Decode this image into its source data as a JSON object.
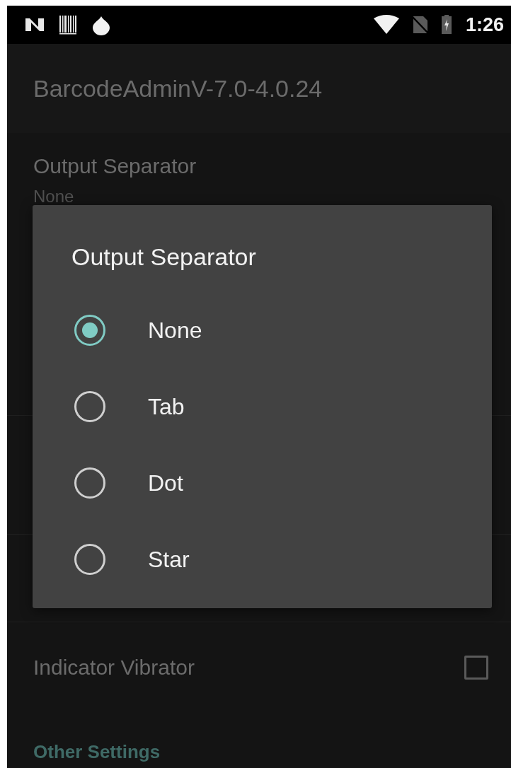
{
  "status_bar": {
    "time": "1:26"
  },
  "app_bar": {
    "title": "BarcodeAdminV-7.0-4.0.24"
  },
  "settings": [
    {
      "kind": "preference",
      "title": "Output Separator",
      "summary": "None"
    },
    {
      "kind": "checkbox",
      "title": "Indicator Vibrator",
      "checked": false
    },
    {
      "kind": "category",
      "title": "Other Settings"
    }
  ],
  "dialog": {
    "title": "Output Separator",
    "options": [
      {
        "label": "None",
        "selected": true
      },
      {
        "label": "Tab",
        "selected": false
      },
      {
        "label": "Dot",
        "selected": false
      },
      {
        "label": "Star",
        "selected": false
      }
    ]
  }
}
